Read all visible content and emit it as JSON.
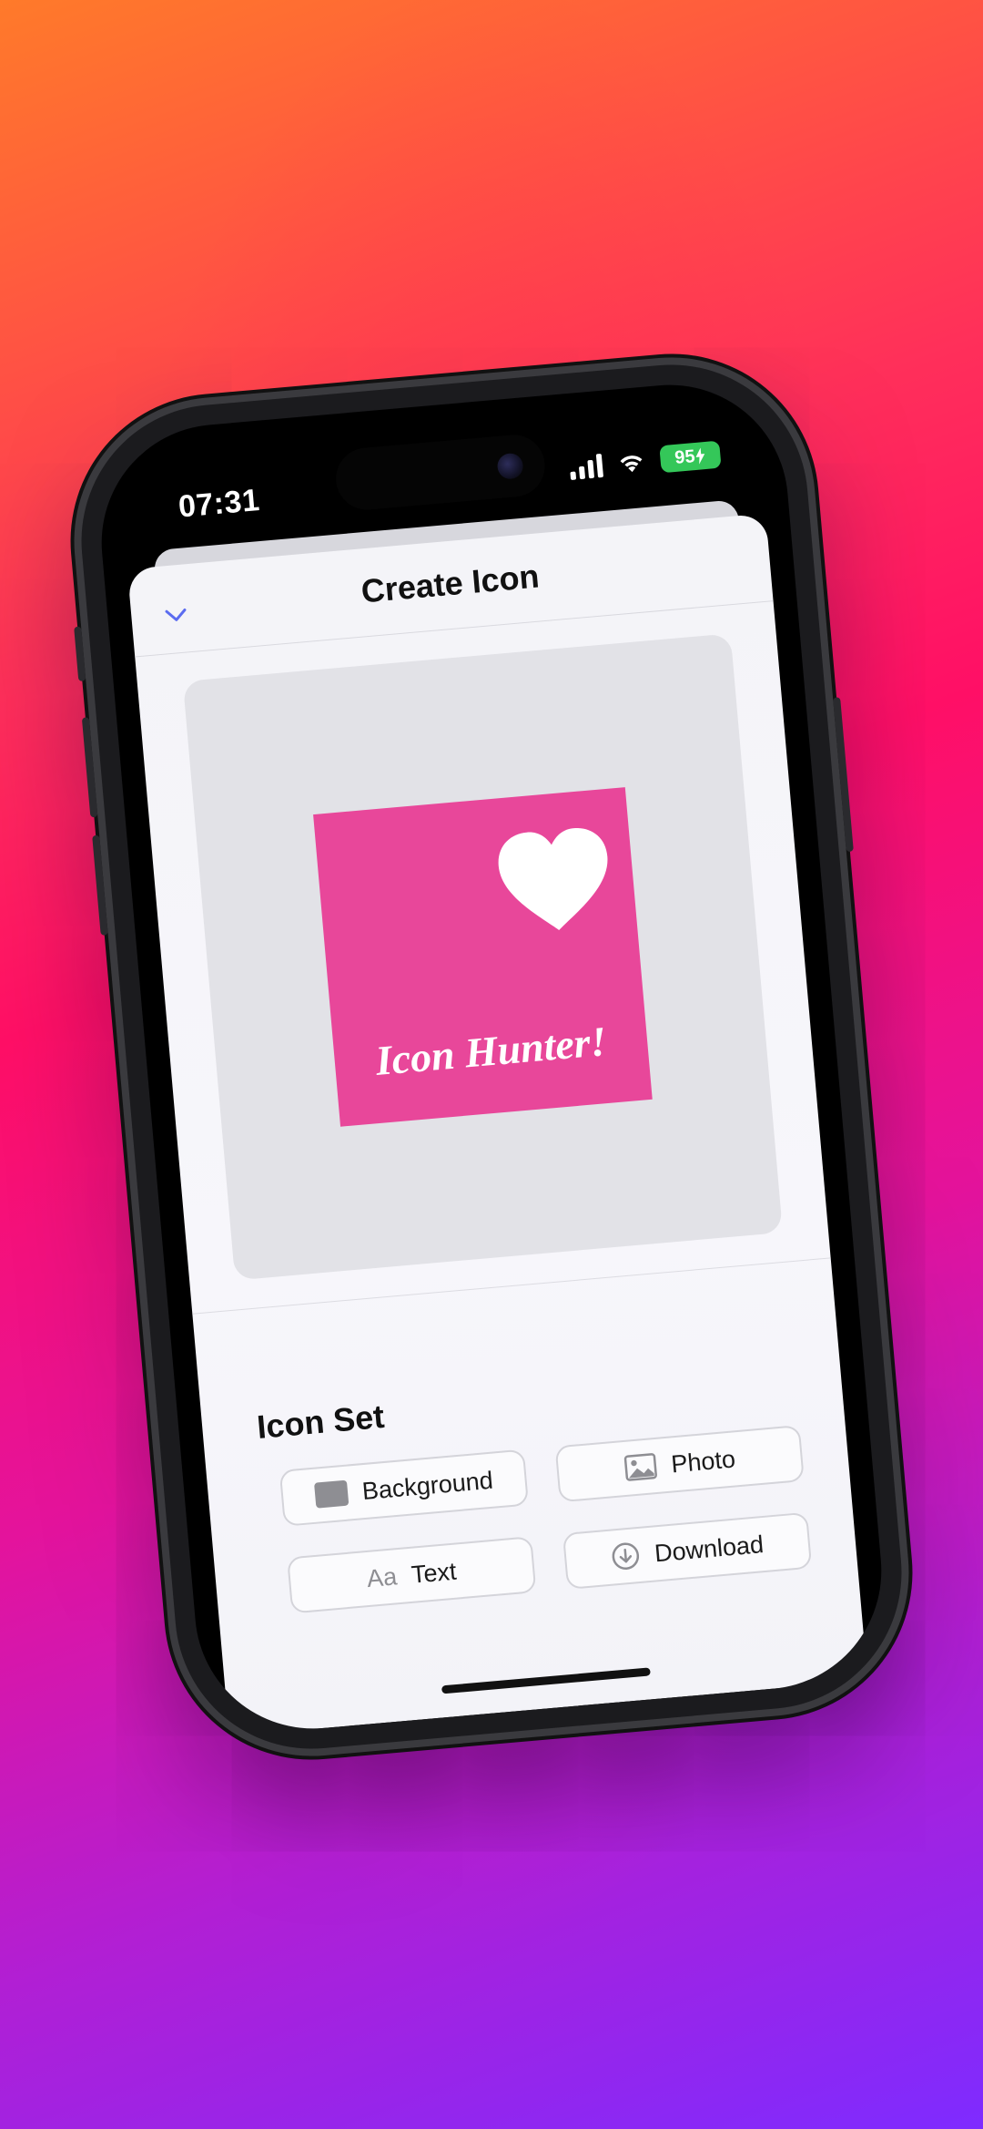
{
  "status_bar": {
    "time": "07:31",
    "battery": "95"
  },
  "sheet": {
    "title": "Create Icon"
  },
  "preview": {
    "tile_text": "Icon Hunter!",
    "tile_color": "#e8479a"
  },
  "icon_set": {
    "title": "Icon Set",
    "buttons": {
      "background": "Background",
      "photo": "Photo",
      "text": "Text",
      "text_glyph": "Aa",
      "download": "Download"
    }
  },
  "colors": {
    "accent": "#5b6cf0",
    "battery": "#34c759"
  }
}
